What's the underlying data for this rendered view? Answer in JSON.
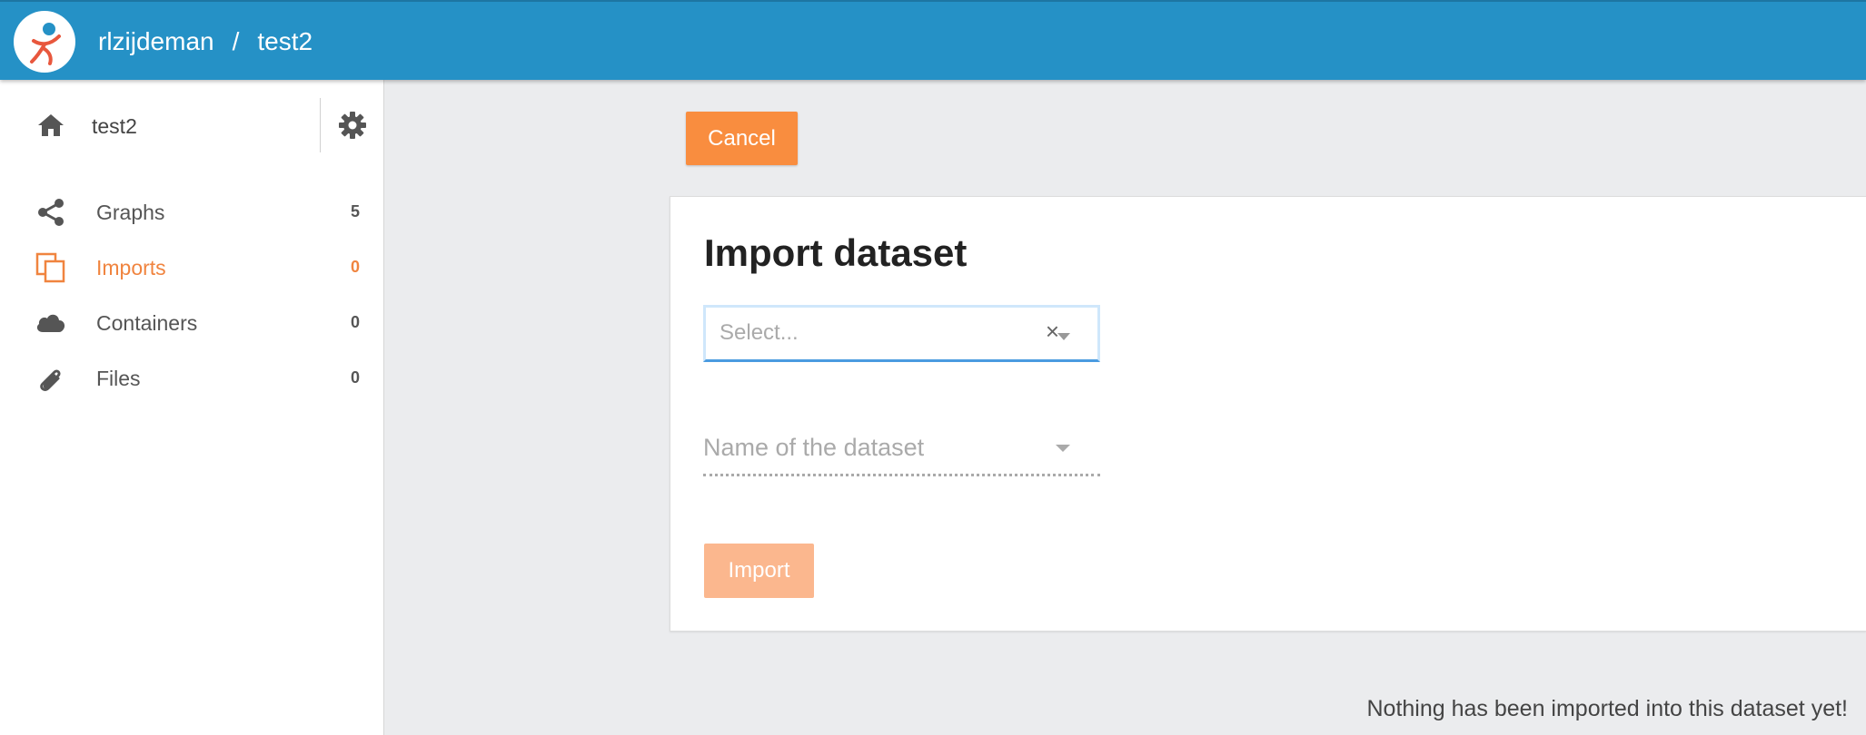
{
  "header": {
    "user": "rlzijdeman",
    "separator": "/",
    "dataset": "test2",
    "bar_color": "#2591c6"
  },
  "sidebar": {
    "home": {
      "label": "test2",
      "icon": "home-icon"
    },
    "settings_icon": "gear-icon",
    "items": [
      {
        "label": "Graphs",
        "count": "5",
        "icon": "share-icon",
        "active": false
      },
      {
        "label": "Imports",
        "count": "0",
        "icon": "copy-icon",
        "active": true
      },
      {
        "label": "Containers",
        "count": "0",
        "icon": "cloud-icon",
        "active": false
      },
      {
        "label": "Files",
        "count": "0",
        "icon": "paperclip-icon",
        "active": false
      }
    ],
    "active_color": "#f0843f"
  },
  "main": {
    "cancel_label": "Cancel",
    "card": {
      "title": "Import dataset",
      "select": {
        "placeholder": "Select...",
        "clear": "×"
      },
      "name_field": {
        "placeholder": "Name of the dataset"
      },
      "import_label": "Import"
    },
    "empty_message": "Nothing has been imported into this dataset yet!",
    "accent_color": "#f98d3f"
  }
}
